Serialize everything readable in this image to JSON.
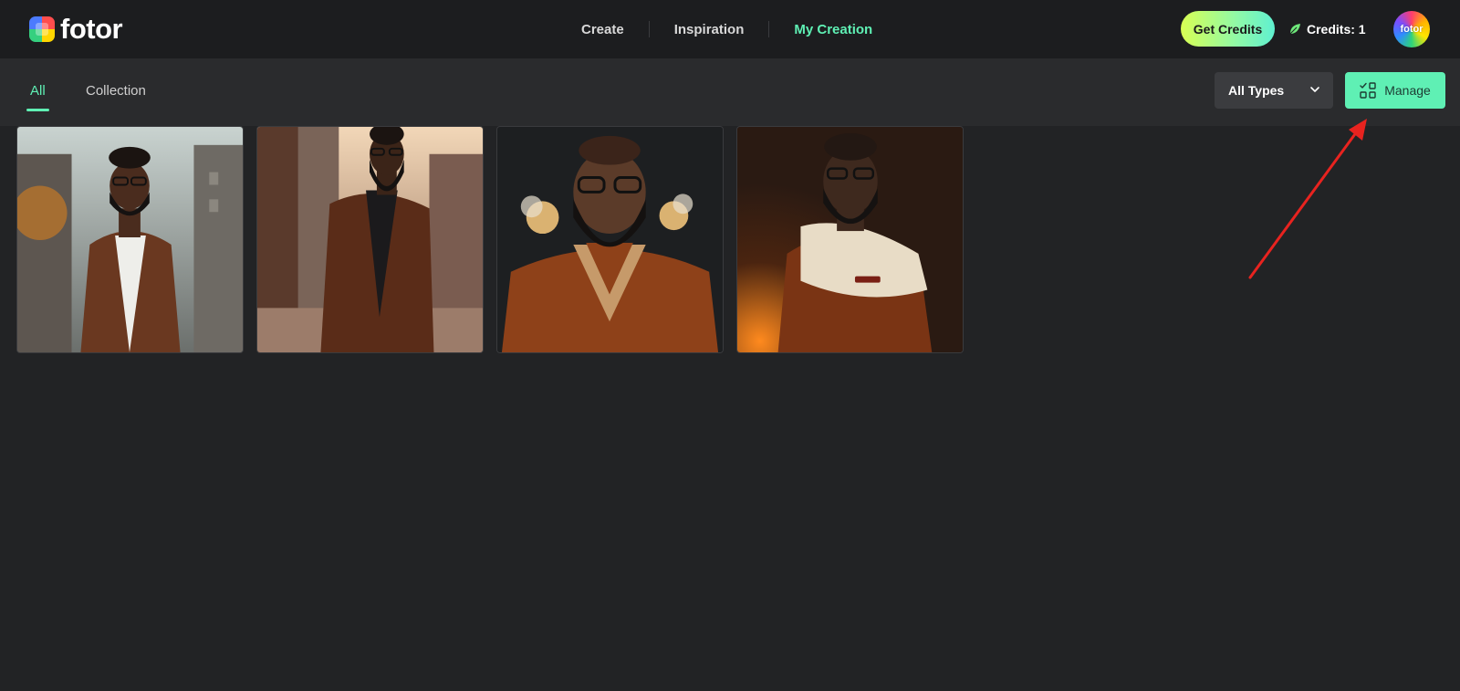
{
  "header": {
    "logo_text": "fotor",
    "nav": [
      {
        "label": "Create",
        "active": false
      },
      {
        "label": "Inspiration",
        "active": false
      },
      {
        "label": "My Creation",
        "active": true
      }
    ],
    "get_credits_label": "Get Credits",
    "credits_label": "Credits: 1",
    "avatar_text": "fotor"
  },
  "subbar": {
    "tabs": [
      {
        "label": "All",
        "active": true
      },
      {
        "label": "Collection",
        "active": false
      }
    ],
    "type_filter": {
      "selected": "All Types"
    },
    "manage_label": "Manage"
  },
  "gallery": {
    "items": [
      {
        "icon": "ai-portrait-image",
        "scene": "city street, daylight"
      },
      {
        "icon": "ai-portrait-image",
        "scene": "city street, sunset"
      },
      {
        "icon": "ai-portrait-image",
        "scene": "dark studio with smoke"
      },
      {
        "icon": "ai-portrait-image",
        "scene": "warm dark studio"
      }
    ]
  },
  "colors": {
    "accent": "#5ff0b4",
    "background": "#222325",
    "header_bg": "#1c1d1f",
    "subbar_bg": "#2a2b2d",
    "annotation": "#e8231f"
  }
}
